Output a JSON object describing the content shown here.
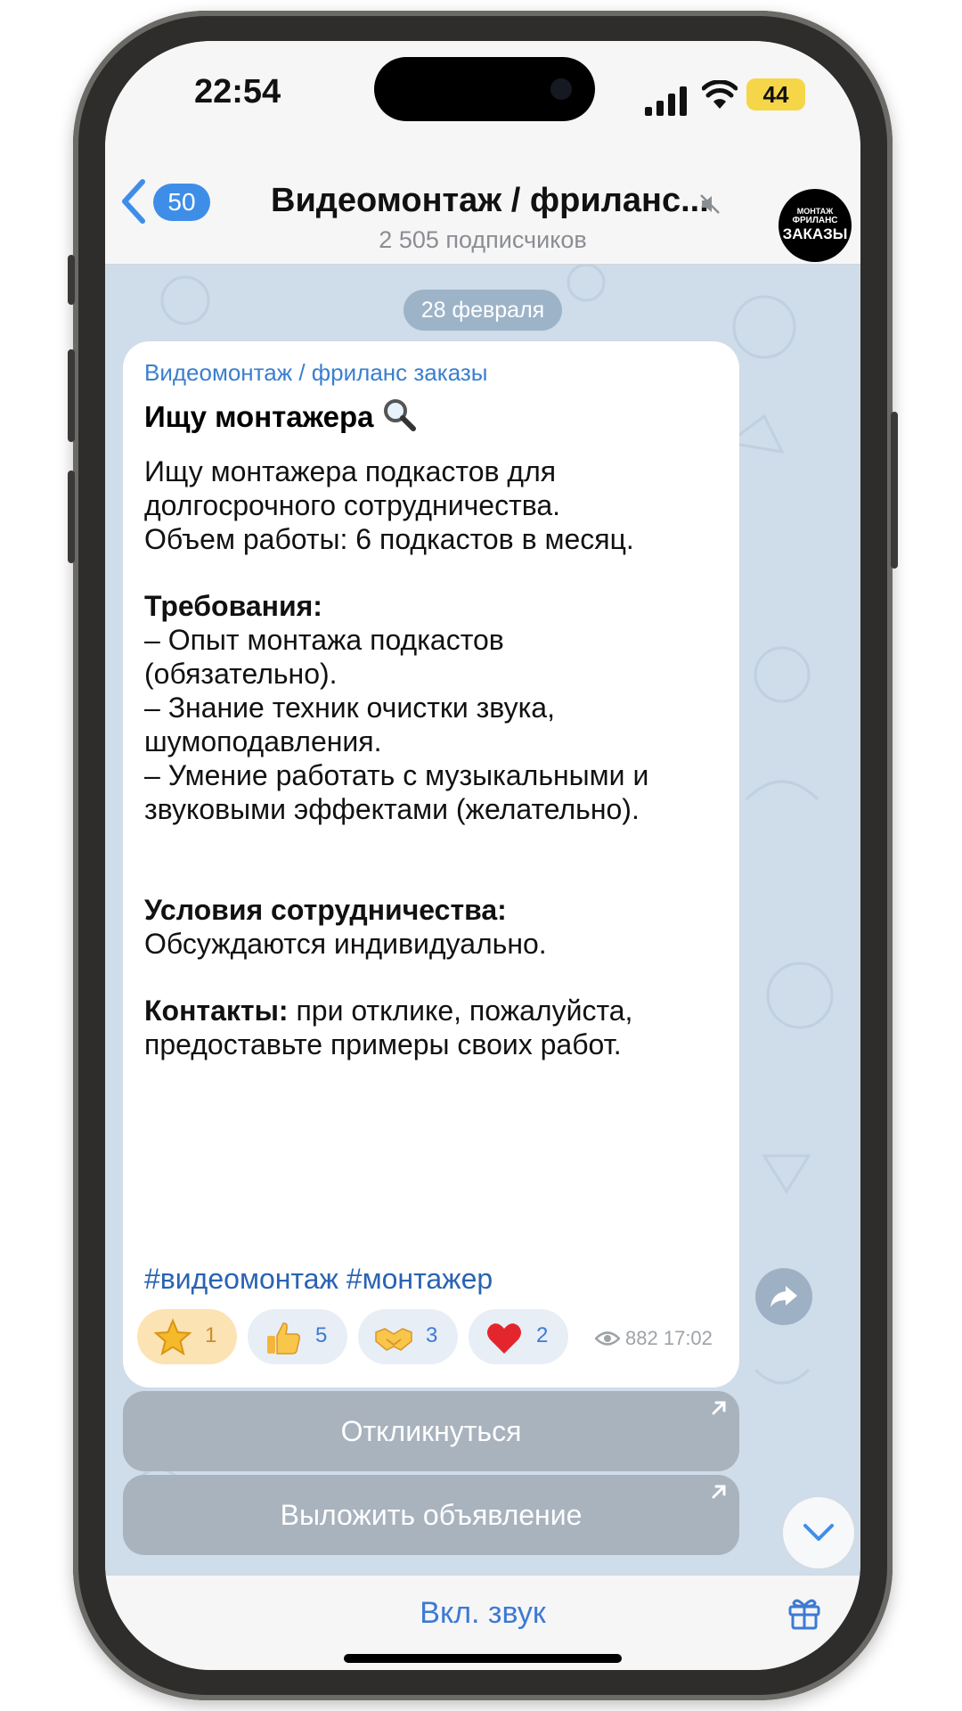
{
  "status_bar": {
    "time": "22:54",
    "battery": "44"
  },
  "header": {
    "back_count": "50",
    "title": "Видеомонтаж / фриланс...",
    "subtitle": "2 505 подписчиков",
    "avatar_lines": [
      "МОНТАЖ",
      "ФРИЛАНС",
      "ЗАКАЗЫ"
    ]
  },
  "chat": {
    "date": "28 февраля",
    "message": {
      "channel": "Видеомонтаж / фриланс заказы",
      "title": "Ищу монтажера",
      "lines": [
        "Ищу монтажера подкастов для",
        "долгосрочного сотрудничества.",
        "Объем работы: 6 подкастов в месяц.",
        "Требования:",
        "– Опыт монтажа подкастов",
        "(обязательно).",
        "– Знание техник очистки звука,",
        "шумоподавления.",
        "– Умение работать с музыкальными  и",
        "звуковыми эффектами (желательно).",
        "Условия сотрудничества:",
        "Обсуждаются индивидуально.",
        "Контакты:",
        " при отклике, пожалуйста,",
        "предоставьте примеры своих работ."
      ],
      "hashtags": "#видеомонтаж #монтажер",
      "reactions": [
        {
          "emoji": "star",
          "count": "1"
        },
        {
          "emoji": "thumbs-up",
          "count": "5"
        },
        {
          "emoji": "handshake",
          "count": "3"
        },
        {
          "emoji": "heart",
          "count": "2"
        }
      ],
      "views": "882",
      "time": "17:02"
    },
    "buttons": [
      "Откликнуться",
      "Выложить объявление"
    ]
  },
  "bottom_bar": {
    "unmute_label": "Вкл. звук"
  }
}
